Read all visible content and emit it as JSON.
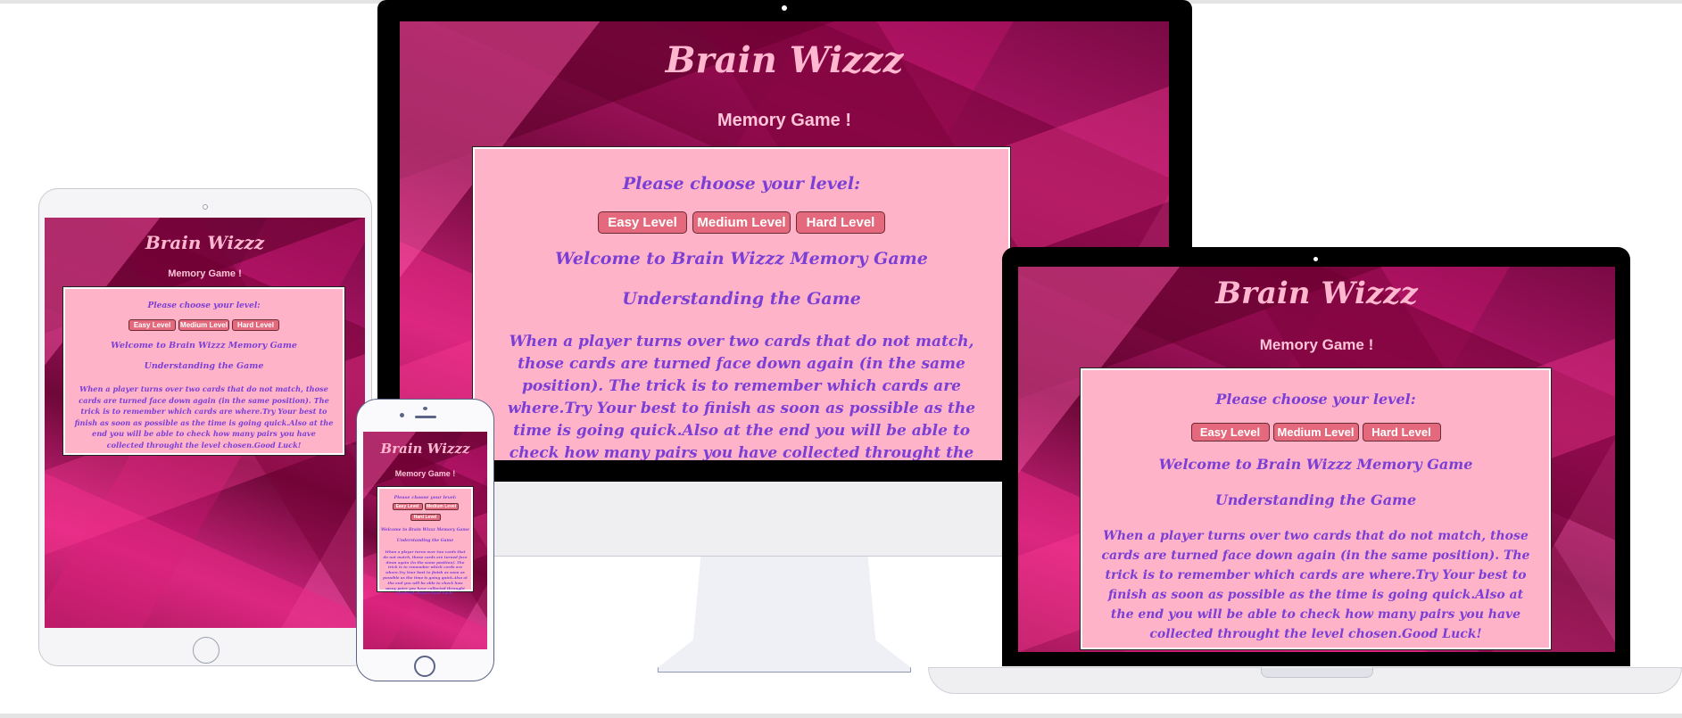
{
  "site": {
    "title": "Brain Wizzz",
    "subtitle": "Memory Game !",
    "choose_level": "Please choose your level:",
    "buttons": [
      "Easy Level",
      "Medium Level",
      "Hard Level"
    ],
    "welcome": "Welcome to Brain Wizzz Memory Game",
    "understanding": "Understanding the Game",
    "description": "When a player turns over two cards that do not match, those cards are turned face down again (in the same position). The trick is to remember which cards are where.Try Your best to finish as soon as possible as the time is going quick.Also at the end you will be able to check how many pairs you have collected throught the level chosen.Good Luck!"
  },
  "colors": {
    "title_pink": "#ffb6cf",
    "panel_bg": "#ffb3c8",
    "panel_text": "#7b3fd6",
    "button_bg": "#e4697c",
    "background_magenta": "#b01568"
  },
  "devices": [
    "desktop-monitor",
    "laptop",
    "tablet",
    "phone"
  ]
}
